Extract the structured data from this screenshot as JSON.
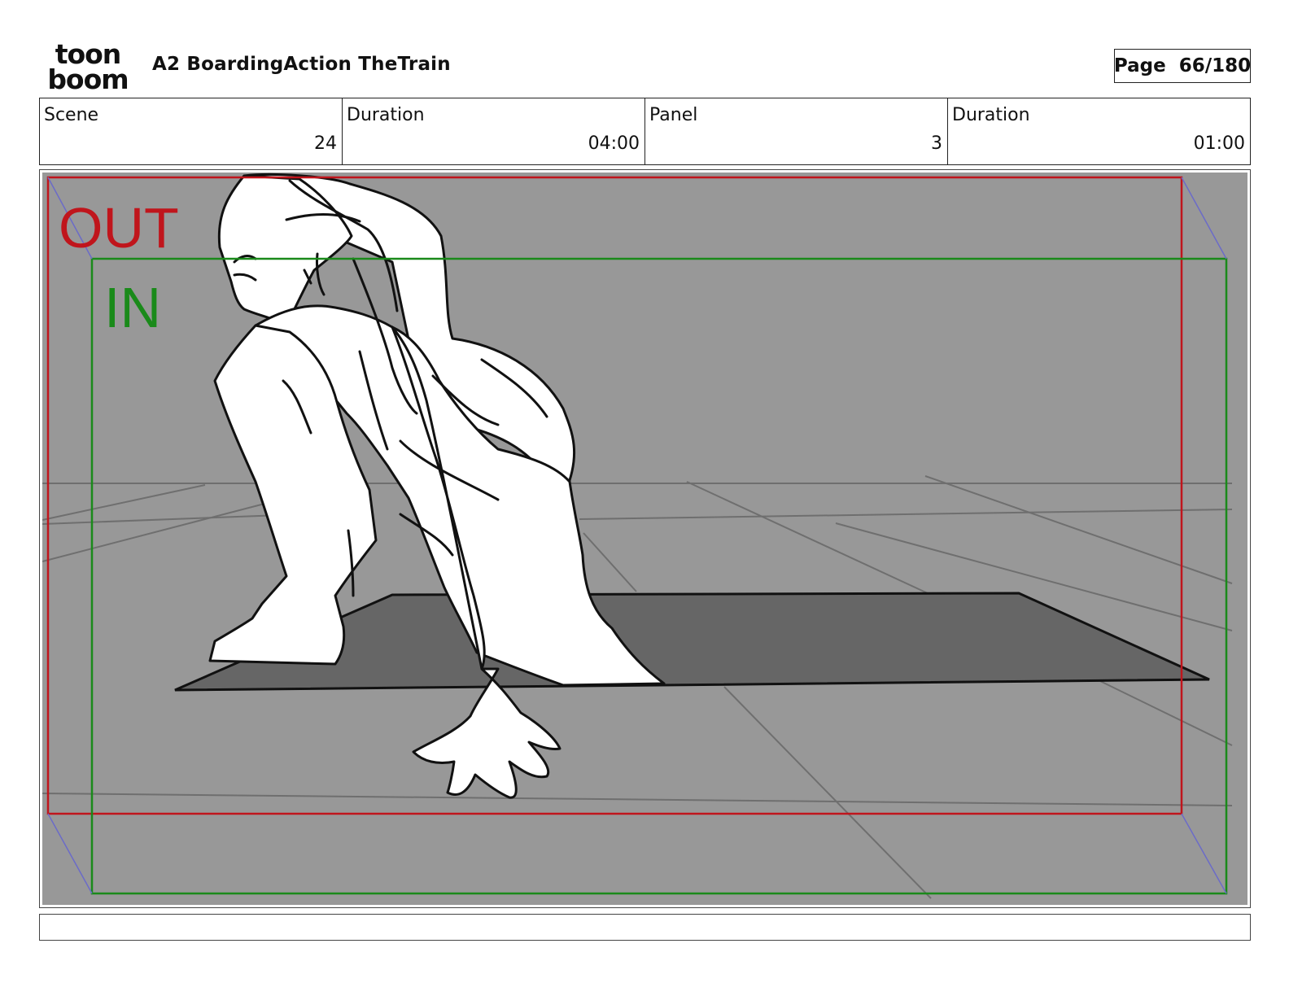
{
  "brand": {
    "logo_top": "toon",
    "logo_bottom": "boom"
  },
  "header": {
    "title": "A2 BoardingAction TheTrain",
    "page_label": "Page",
    "page_number": "66/180"
  },
  "info": {
    "scene_label": "Scene",
    "scene_value": "24",
    "scene_duration_label": "Duration",
    "scene_duration_value": "04:00",
    "panel_label": "Panel",
    "panel_value": "3",
    "panel_duration_label": "Duration",
    "panel_duration_value": "01:00"
  },
  "panel": {
    "out_label": "OUT",
    "in_label": "IN",
    "colors": {
      "background": "#989898",
      "out_frame": "#c0151c",
      "in_frame": "#1a8a1a",
      "hole": "#666666",
      "camera_path": "#6b6bc8"
    }
  },
  "caption": {
    "text": ""
  }
}
